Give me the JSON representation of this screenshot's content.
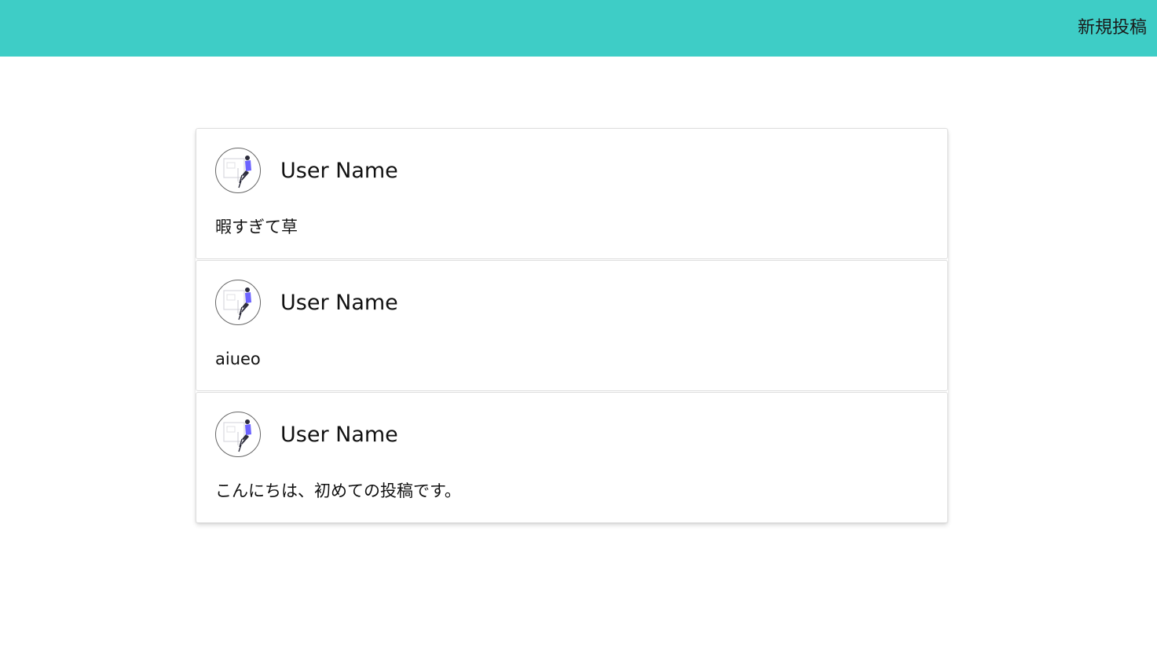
{
  "header": {
    "new_post_label": "新規投稿",
    "background_color": "#3ecdc6"
  },
  "posts": [
    {
      "user_name": "User Name",
      "text": "暇すぎて草",
      "avatar_icon": "person-illustration-icon"
    },
    {
      "user_name": "User Name",
      "text": "aiueo",
      "avatar_icon": "person-illustration-icon"
    },
    {
      "user_name": "User Name",
      "text": "こんにちは、初めての投稿です。",
      "avatar_icon": "person-illustration-icon"
    }
  ]
}
